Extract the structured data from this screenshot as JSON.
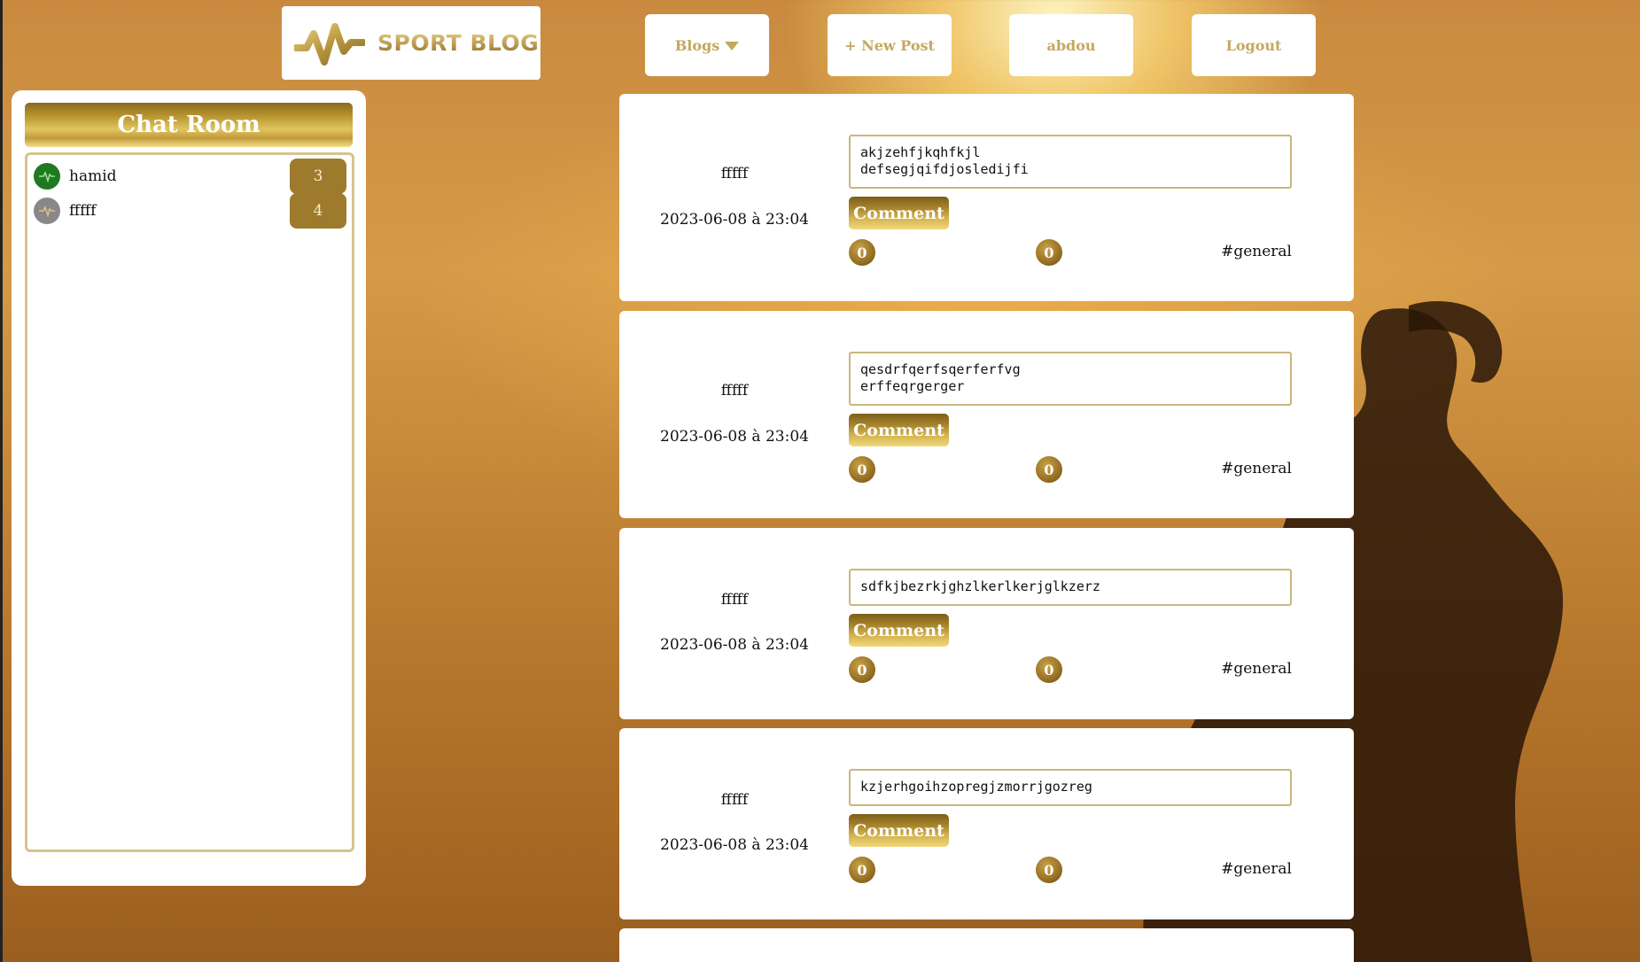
{
  "header": {
    "logo_text": "SPORT BLOG",
    "nav": {
      "blogs": "Blogs",
      "new_post": "+ New Post",
      "user": "abdou",
      "logout": "Logout"
    }
  },
  "chat": {
    "title": "Chat Room",
    "users": [
      {
        "name": "hamid",
        "count": "3",
        "status": "online"
      },
      {
        "name": "fffff",
        "count": "4",
        "status": "offline"
      }
    ]
  },
  "posts": [
    {
      "author": "fffff",
      "date": "2023-06-08 à 23:04",
      "content": "akjzehfjkqhfkjl\ndefsegjqifdjoslедijfi",
      "comment_label": "Comment",
      "likes": "0",
      "dislikes": "0",
      "tag": "#general"
    },
    {
      "author": "fffff",
      "date": "2023-06-08 à 23:04",
      "content": "qesdrfqerfsqerferfvg\nerffeqrgerger",
      "comment_label": "Comment",
      "likes": "0",
      "dislikes": "0",
      "tag": "#general"
    },
    {
      "author": "fffff",
      "date": "2023-06-08 à 23:04",
      "content": "sdfkjbezrkjghzlkerlkerjglkzerz",
      "comment_label": "Comment",
      "likes": "0",
      "dislikes": "0",
      "tag": "#general"
    },
    {
      "author": "fffff",
      "date": "2023-06-08 à 23:04",
      "content": "kzjerhgoihzopregjzmorrjgozreg",
      "comment_label": "Comment",
      "likes": "0",
      "dislikes": "0",
      "tag": "#general"
    }
  ],
  "colors": {
    "gold": "#c4a85e",
    "online": "#1f7a1f",
    "offline": "#888888"
  }
}
